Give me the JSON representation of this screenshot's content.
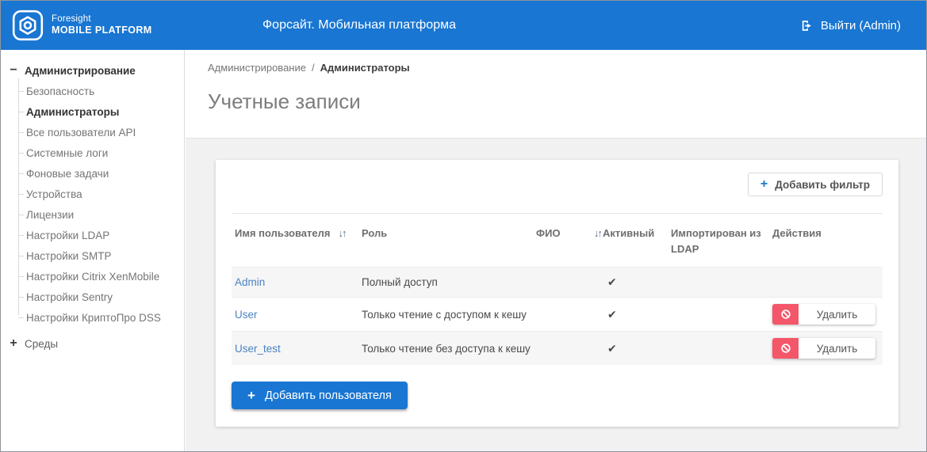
{
  "header": {
    "logo": {
      "line1": "Foresight",
      "line2": "MOBILE PLATFORM"
    },
    "title": "Форсайт. Мобильная платформа",
    "logout_label": "Выйти (Admin)"
  },
  "sidebar": {
    "root": {
      "label": "Администрирование",
      "collapse_glyph": "−"
    },
    "items": [
      {
        "label": "Безопасность",
        "active": false
      },
      {
        "label": "Администраторы",
        "active": true
      },
      {
        "label": "Все пользователи API",
        "active": false
      },
      {
        "label": "Системные логи",
        "active": false
      },
      {
        "label": "Фоновые задачи",
        "active": false
      },
      {
        "label": "Устройства",
        "active": false
      },
      {
        "label": "Лицензии",
        "active": false
      },
      {
        "label": "Настройки LDAP",
        "active": false
      },
      {
        "label": "Настройки SMTP",
        "active": false
      },
      {
        "label": "Настройки Citrix XenMobile",
        "active": false
      },
      {
        "label": "Настройки Sentry",
        "active": false
      },
      {
        "label": "Настройки КриптоПро DSS",
        "active": false
      }
    ],
    "collapsed_root": {
      "label": "Среды",
      "expand_glyph": "+"
    }
  },
  "breadcrumb": {
    "parent": "Администрирование",
    "separator": "/",
    "current": "Администраторы"
  },
  "page": {
    "title": "Учетные записи"
  },
  "toolbar": {
    "add_filter_label": "Добавить фильтр",
    "plus_glyph": "+"
  },
  "table": {
    "columns": [
      {
        "label": "Имя пользователя",
        "sortable": true
      },
      {
        "label": "Роль",
        "sortable": false
      },
      {
        "label": "ФИО",
        "sortable": true
      },
      {
        "label": "Активный",
        "sortable": false
      },
      {
        "label": "Импортирован из LDAP",
        "sortable": false
      },
      {
        "label": "Действия",
        "sortable": false
      }
    ],
    "sort_glyph": "↓↑",
    "check_glyph": "✔",
    "delete_label": "Удалить",
    "rows": [
      {
        "username": "Admin",
        "role": "Полный доступ",
        "fio": "",
        "active": true,
        "imported_from_ldap": false,
        "deletable": false
      },
      {
        "username": "User",
        "role": "Только чтение с доступом к кешу",
        "fio": "",
        "active": true,
        "imported_from_ldap": false,
        "deletable": true
      },
      {
        "username": "User_test",
        "role": "Только чтение без доступа к кешу",
        "fio": "",
        "active": true,
        "imported_from_ldap": false,
        "deletable": true
      }
    ]
  },
  "actions": {
    "add_user_label": "Добавить пользователя",
    "plus_glyph": "+"
  },
  "colors": {
    "header_bg": "#1976d2",
    "accent_blue": "#1976d2",
    "link_blue": "#4a82c3",
    "delete_red": "#f4566a",
    "content_bg": "#f1f1f1"
  }
}
